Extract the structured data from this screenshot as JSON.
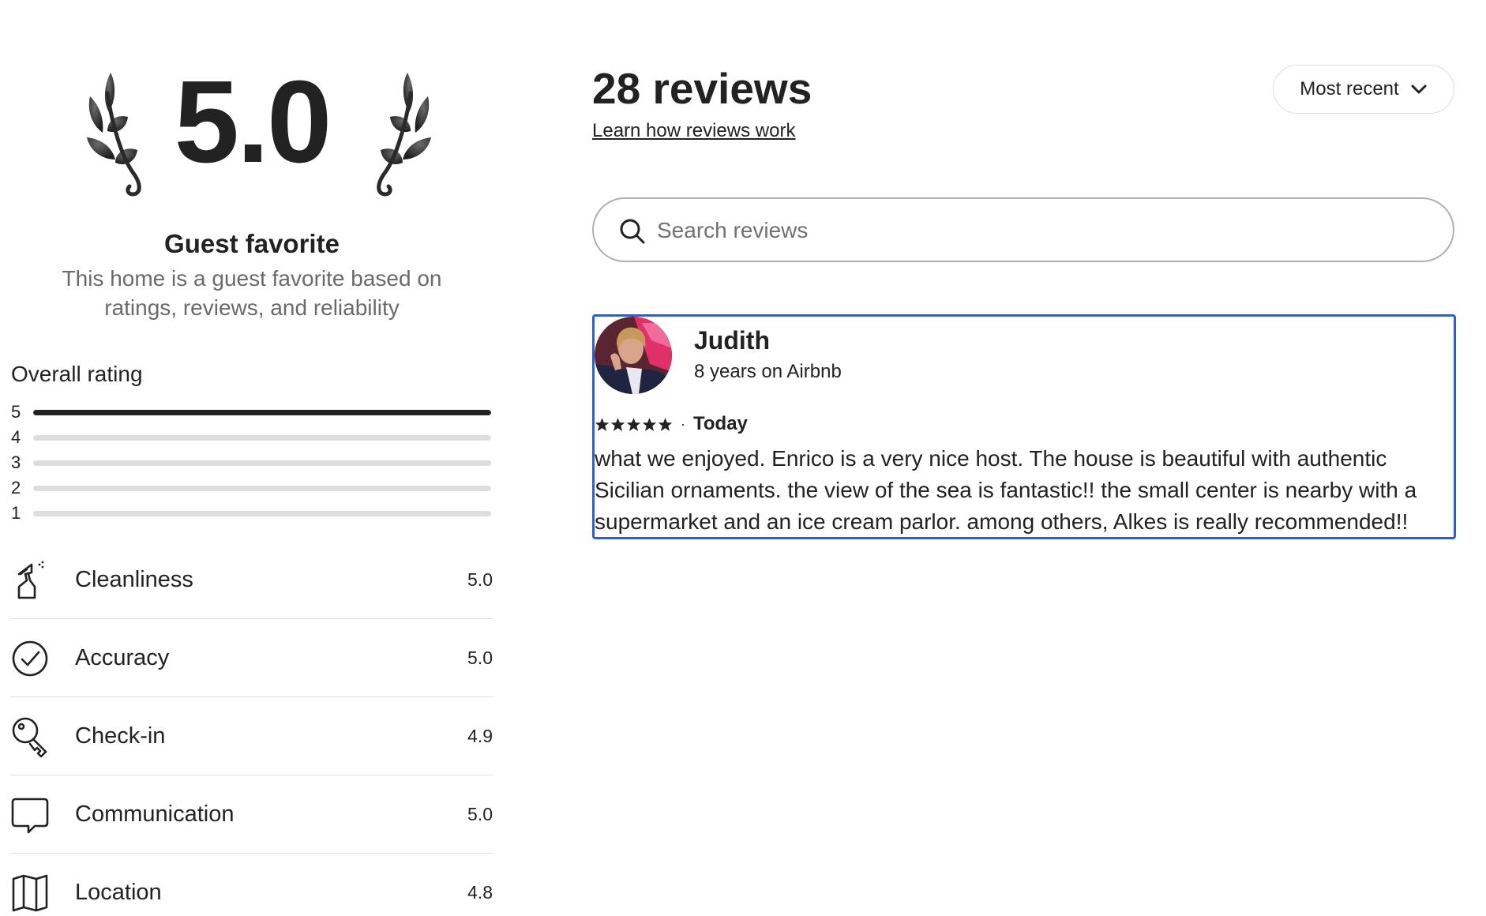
{
  "summary": {
    "overall_score": "5.0",
    "badge_title": "Guest favorite",
    "badge_subtitle": "This home is a guest favorite based on ratings, reviews, and reliability"
  },
  "overall_rating": {
    "title": "Overall rating",
    "distribution": [
      {
        "stars": "5",
        "fraction": 1.0
      },
      {
        "stars": "4",
        "fraction": 0.0
      },
      {
        "stars": "3",
        "fraction": 0.0
      },
      {
        "stars": "2",
        "fraction": 0.0
      },
      {
        "stars": "1",
        "fraction": 0.0
      }
    ]
  },
  "categories": [
    {
      "label": "Cleanliness",
      "score": "5.0",
      "icon": "spray-bottle-icon"
    },
    {
      "label": "Accuracy",
      "score": "5.0",
      "icon": "check-circle-icon"
    },
    {
      "label": "Check-in",
      "score": "4.9",
      "icon": "key-icon"
    },
    {
      "label": "Communication",
      "score": "5.0",
      "icon": "chat-bubble-icon"
    },
    {
      "label": "Location",
      "score": "4.8",
      "icon": "map-icon"
    }
  ],
  "reviews_header": {
    "count_title": "28 reviews",
    "learn_link": "Learn how reviews work",
    "sort_label": "Most recent"
  },
  "search": {
    "placeholder": "Search reviews",
    "value": ""
  },
  "review": {
    "name": "Judith",
    "meta": "8 years on Airbnb",
    "stars": 5,
    "date": "Today",
    "text": "what we enjoyed. Enrico is a very nice host. The house is beautiful with authentic Sicilian ornaments. the view of the sea is fantastic!! the small center is nearby with a supermarket and an ice cream parlor. among others, Alkes is really recommended!!"
  },
  "colors": {
    "text": "#222222",
    "muted": "#6a6a6a",
    "track": "#dddddd",
    "focus_outline": "#2e5fd0"
  }
}
